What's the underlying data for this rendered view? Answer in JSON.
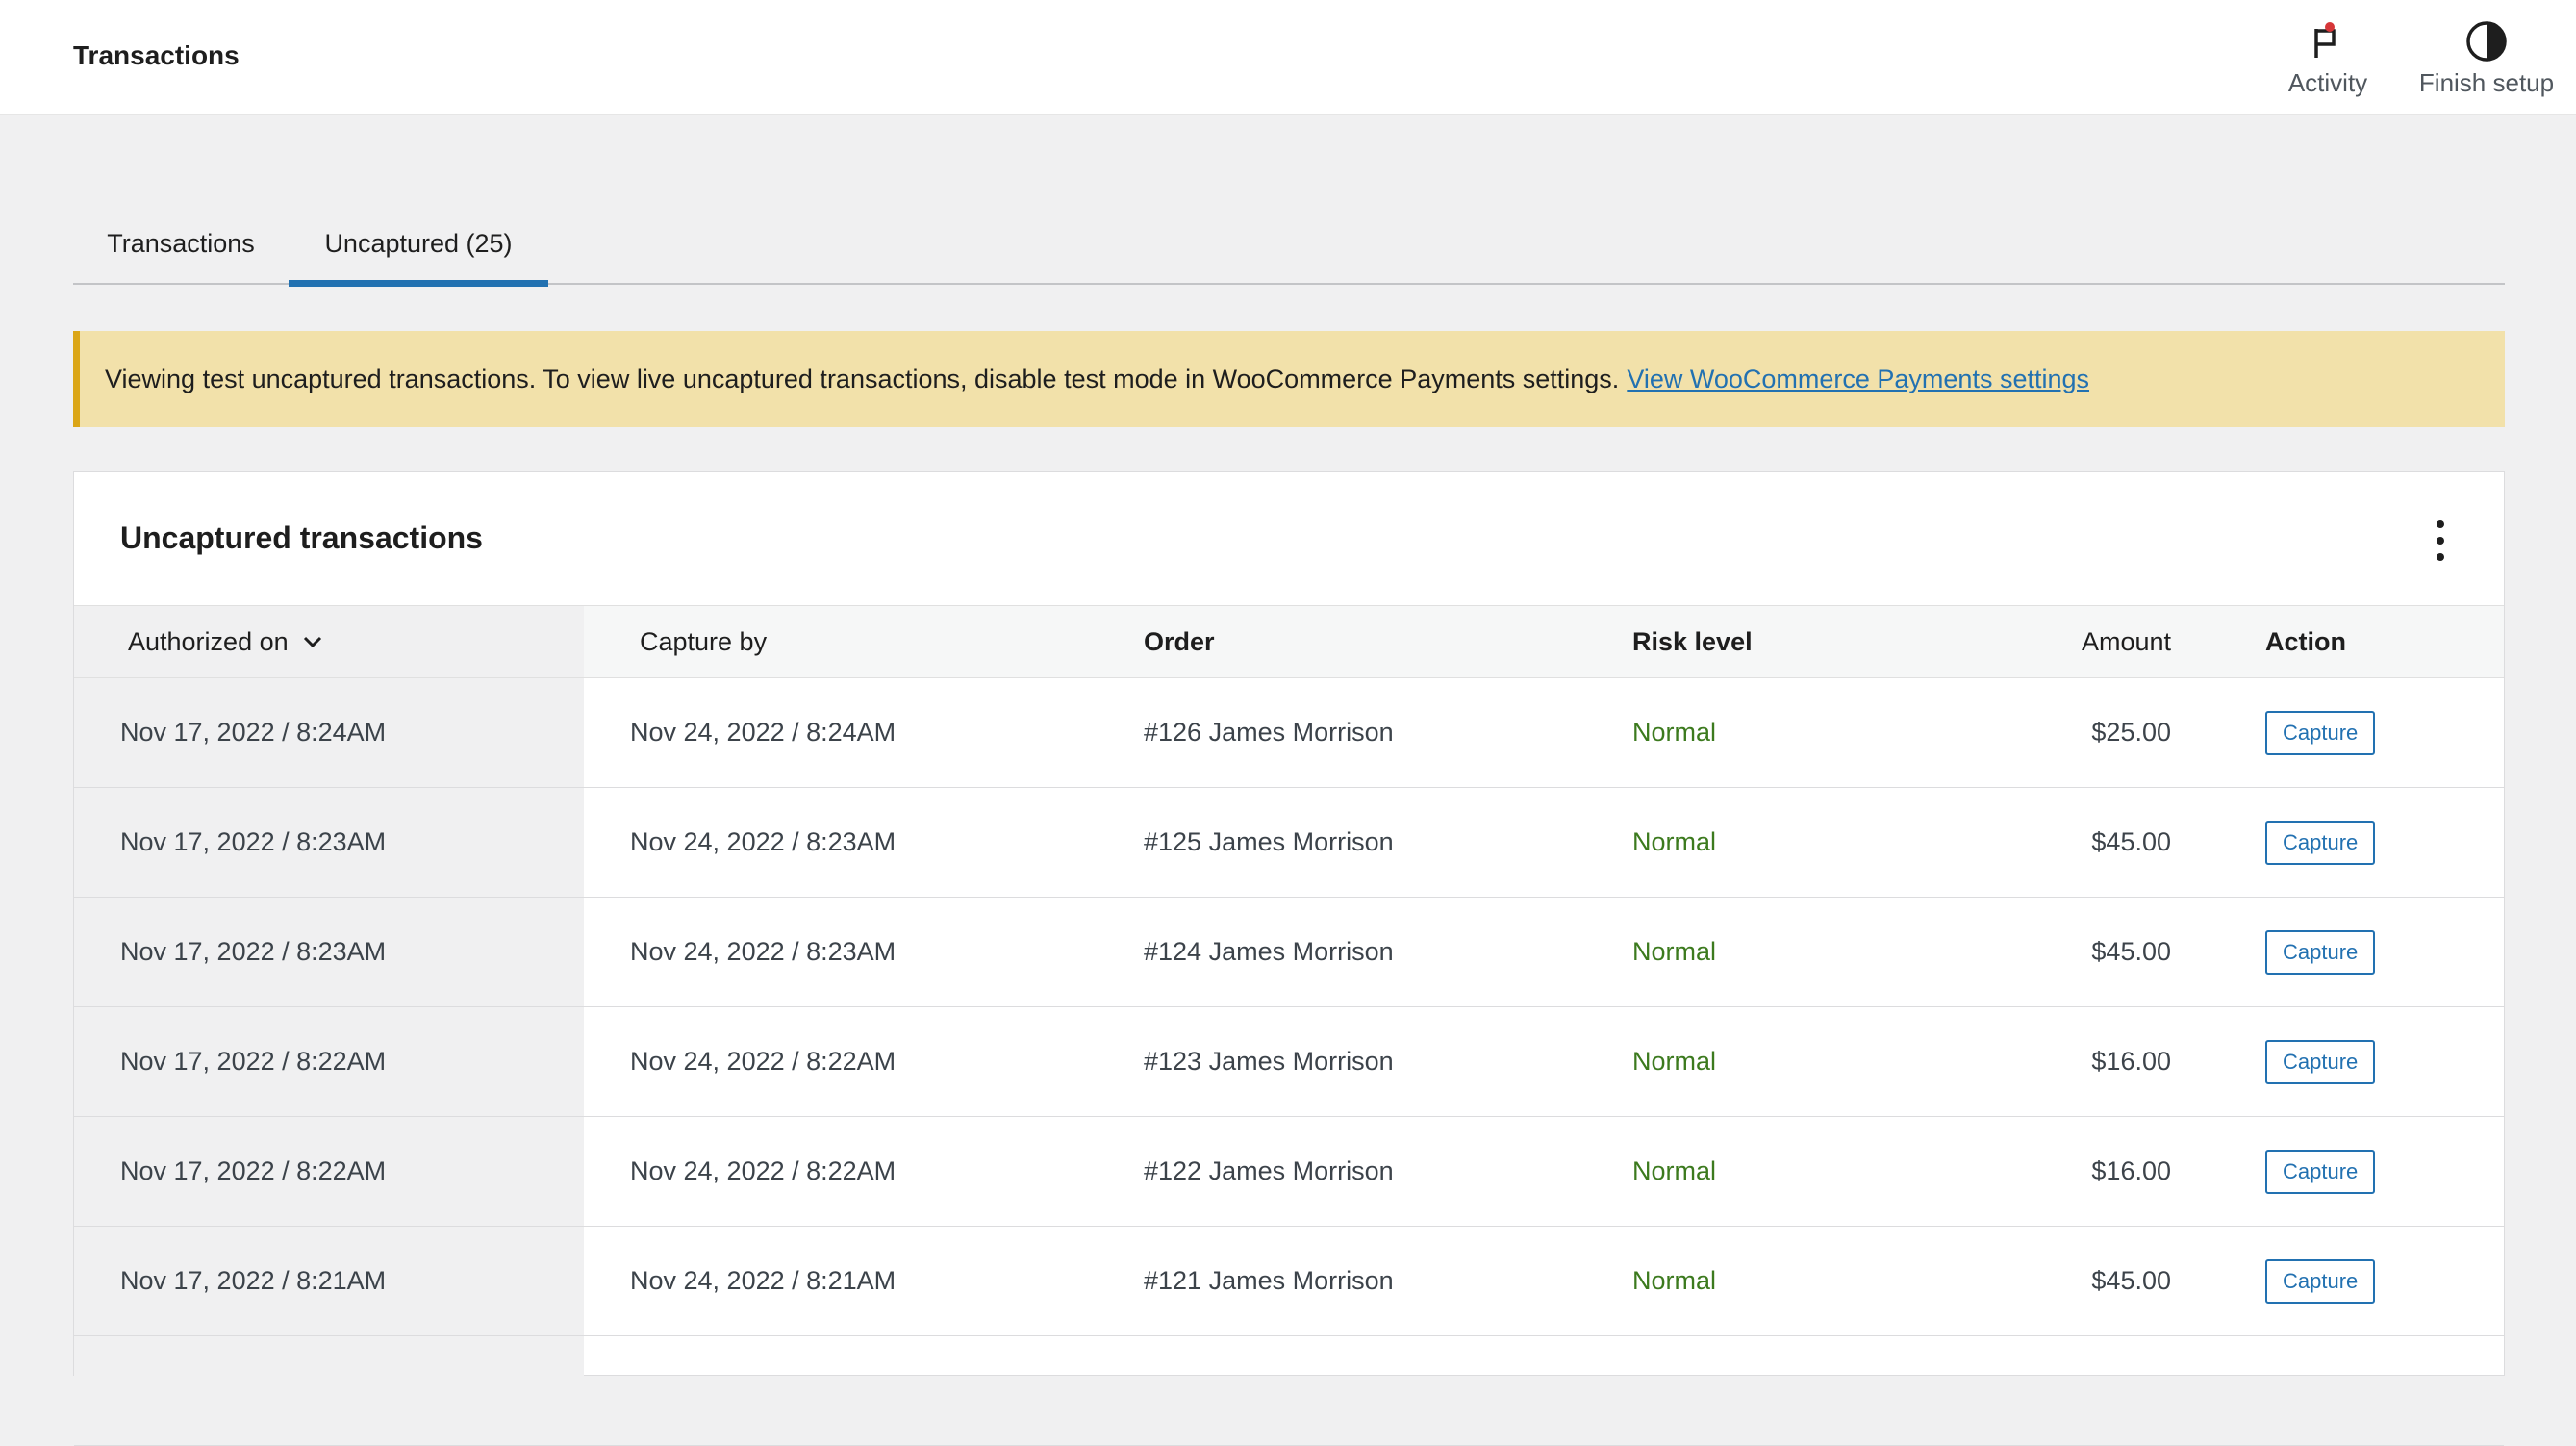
{
  "header": {
    "title": "Transactions",
    "actions": [
      {
        "label": "Activity",
        "icon": "flag-icon"
      },
      {
        "label": "Finish setup",
        "icon": "half-circle-icon"
      }
    ]
  },
  "tabs": [
    {
      "label": "Transactions",
      "active": false
    },
    {
      "label": "Uncaptured (25)",
      "active": true
    }
  ],
  "notice": {
    "text": "Viewing test uncaptured transactions. To view live uncaptured transactions, disable test mode in WooCommerce Payments settings.",
    "link": "View WooCommerce Payments settings"
  },
  "card": {
    "title": "Uncaptured transactions"
  },
  "table": {
    "columns": [
      "Authorized on",
      "Capture by",
      "Order",
      "Risk level",
      "Amount",
      "Action"
    ],
    "rows": [
      {
        "authorized": "Nov 17, 2022 / 8:24AM",
        "capture_by": "Nov 24, 2022 / 8:24AM",
        "order": "#126 James Morrison",
        "risk": "Normal",
        "amount": "$25.00",
        "action": "Capture"
      },
      {
        "authorized": "Nov 17, 2022 / 8:23AM",
        "capture_by": "Nov 24, 2022 / 8:23AM",
        "order": "#125 James Morrison",
        "risk": "Normal",
        "amount": "$45.00",
        "action": "Capture"
      },
      {
        "authorized": "Nov 17, 2022 / 8:23AM",
        "capture_by": "Nov 24, 2022 / 8:23AM",
        "order": "#124 James Morrison",
        "risk": "Normal",
        "amount": "$45.00",
        "action": "Capture"
      },
      {
        "authorized": "Nov 17, 2022 / 8:22AM",
        "capture_by": "Nov 24, 2022 / 8:22AM",
        "order": "#123 James Morrison",
        "risk": "Normal",
        "amount": "$16.00",
        "action": "Capture"
      },
      {
        "authorized": "Nov 17, 2022 / 8:22AM",
        "capture_by": "Nov 24, 2022 / 8:22AM",
        "order": "#122 James Morrison",
        "risk": "Normal",
        "amount": "$16.00",
        "action": "Capture"
      },
      {
        "authorized": "Nov 17, 2022 / 8:21AM",
        "capture_by": "Nov 24, 2022 / 8:21AM",
        "order": "#121 James Morrison",
        "risk": "Normal",
        "amount": "$45.00",
        "action": "Capture"
      },
      {
        "authorized": "",
        "capture_by": "",
        "order": "",
        "risk": "",
        "amount": "",
        "action": ""
      }
    ]
  },
  "colors": {
    "accent": "#2271b1",
    "notice_bg": "#f2e1aa",
    "notice_border": "#dba617",
    "risk_normal": "#3c7a1e",
    "activity_dot": "#d63638"
  }
}
